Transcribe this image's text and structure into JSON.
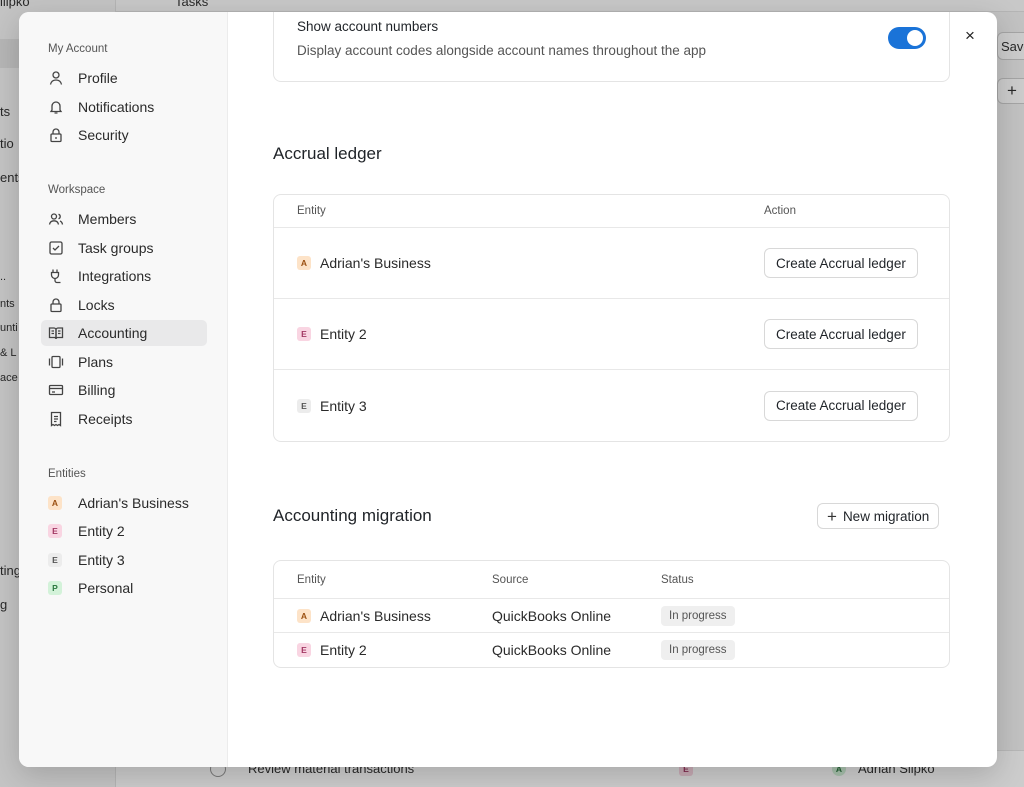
{
  "background": {
    "top_left_text": "ilipko",
    "top_tab_text": "Tasks",
    "save_label": "Save",
    "plus_label": "+",
    "sidebar_fragments": [
      "ts",
      "tio",
      "ents",
      "..",
      "nts",
      "unti",
      "& L",
      "ace S",
      "ting",
      "g"
    ],
    "bg_row_text": "Review material transactions",
    "bg_row_badge": "E",
    "bg_row_user_badge": "A",
    "bg_row_user": "Adrian Slipko"
  },
  "nav": {
    "my_account_label": "My Account",
    "my_account_items": [
      {
        "label": "Profile",
        "icon": "user-icon"
      },
      {
        "label": "Notifications",
        "icon": "bell-icon"
      },
      {
        "label": "Security",
        "icon": "lock-icon"
      }
    ],
    "workspace_label": "Workspace",
    "workspace_items": [
      {
        "label": "Members",
        "icon": "users-icon"
      },
      {
        "label": "Task groups",
        "icon": "task-groups-icon"
      },
      {
        "label": "Integrations",
        "icon": "plug-icon"
      },
      {
        "label": "Locks",
        "icon": "lock-icon"
      },
      {
        "label": "Accounting",
        "icon": "book-icon",
        "active": true
      },
      {
        "label": "Plans",
        "icon": "plans-icon"
      },
      {
        "label": "Billing",
        "icon": "card-icon"
      },
      {
        "label": "Receipts",
        "icon": "receipt-icon"
      }
    ],
    "entities_label": "Entities",
    "entities": [
      {
        "badge": "A",
        "label": "Adrian's Business"
      },
      {
        "badge": "E",
        "label": "Entity 2"
      },
      {
        "badge": "E",
        "label": "Entity 3"
      },
      {
        "badge": "P",
        "label": "Personal"
      }
    ]
  },
  "close_label": "×",
  "account_numbers": {
    "title": "Show account numbers",
    "description": "Display account codes alongside account names throughout the app",
    "enabled": true
  },
  "accrual": {
    "title": "Accrual ledger",
    "col_entity": "Entity",
    "col_action": "Action",
    "rows": [
      {
        "badge": "A",
        "entity": "Adrian's Business",
        "action": "Create Accrual ledger"
      },
      {
        "badge": "E",
        "entity": "Entity 2",
        "action": "Create Accrual ledger"
      },
      {
        "badge": "E",
        "entity": "Entity 3",
        "action": "Create Accrual ledger"
      }
    ]
  },
  "migration": {
    "title": "Accounting migration",
    "new_button": "New migration",
    "col_entity": "Entity",
    "col_source": "Source",
    "col_status": "Status",
    "rows": [
      {
        "badge": "A",
        "entity": "Adrian's Business",
        "source": "QuickBooks Online",
        "status": "In progress"
      },
      {
        "badge": "E",
        "entity": "Entity 2",
        "source": "QuickBooks Online",
        "status": "In progress"
      }
    ]
  },
  "colors": {
    "toggle_on": "#1a73d8",
    "badge_a_bg": "#fde3c8",
    "badge_e_bg": "#f9d5e2",
    "badge_p_bg": "#d3f2d9"
  }
}
